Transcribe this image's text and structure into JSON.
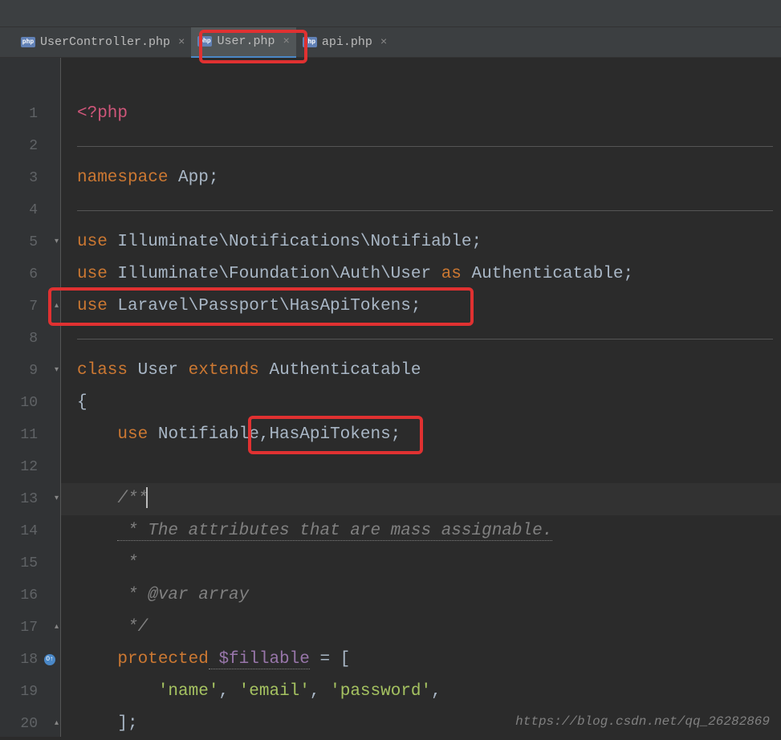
{
  "tabs": [
    {
      "label": "UserController.php",
      "active": false
    },
    {
      "label": "User.php",
      "active": true
    },
    {
      "label": "api.php",
      "active": false
    }
  ],
  "php_icon_text": "php",
  "close_glyph": "×",
  "line_numbers": [
    "1",
    "2",
    "3",
    "4",
    "5",
    "6",
    "7",
    "8",
    "9",
    "10",
    "11",
    "12",
    "13",
    "14",
    "15",
    "16",
    "17",
    "18",
    "19",
    "20"
  ],
  "code": {
    "php_open": "<?php",
    "ns_kw": "namespace",
    "ns_name": " App;",
    "use_kw": "use",
    "use1": " Illuminate\\Notifications\\Notifiable;",
    "use2a": " Illuminate\\Foundation\\Auth\\User ",
    "as_kw": "as",
    "use2b": " Authenticatable;",
    "use3": " Laravel\\Passport\\HasApiTokens;",
    "class_kw": "class",
    "class_name": " User ",
    "extends_kw": "extends",
    "extends_name": " Authenticatable",
    "brace_open": "{",
    "trait_use": " Notifiable,HasApiTokens;",
    "doc_open": "/**",
    "doc_l1": " * The attributes that are mass assignable.",
    "doc_l2": " *",
    "doc_l3": " * @var array",
    "doc_close": " */",
    "protected_kw": "protected",
    "var_fillable": " $fillable",
    "eq_bracket": " = [",
    "str_name": "'name'",
    "str_email": "'email'",
    "str_password": "'password'",
    "comma_sep": ", ",
    "comma_end": ",",
    "bracket_close": "];"
  },
  "override_icon_text": "O↑",
  "watermark": "https://blog.csdn.net/qq_26282869"
}
